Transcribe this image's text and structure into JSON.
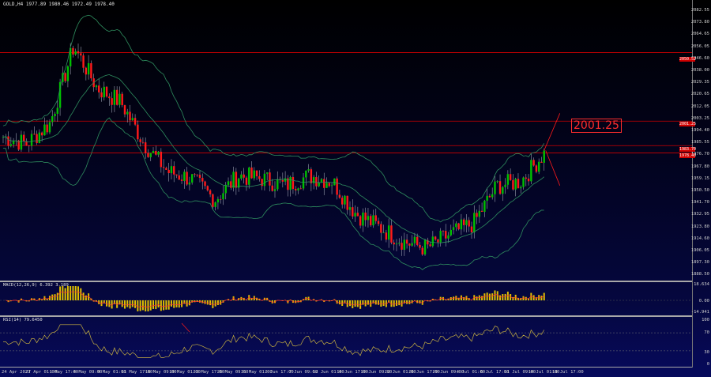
{
  "chart": {
    "symbol_header": "GOLD,H4  1977.89 1980.46 1972.49 1978.40",
    "callout_price": "2001.25",
    "price_axis": [
      "2082.55",
      "2073.80",
      "2064.65",
      "2056.05",
      "2046.60",
      "2038.00",
      "2029.35",
      "2020.65",
      "2012.05",
      "2003.25",
      "1994.40",
      "1985.55",
      "1976.70",
      "1967.80",
      "1959.15",
      "1950.50",
      "1941.70",
      "1932.95",
      "1923.80",
      "1914.60",
      "1906.05",
      "1897.30",
      "1888.50"
    ],
    "time_axis": [
      "24 Apr 2023",
      "27 Apr 01:00",
      "1 May 17:00",
      "4 May 09:00",
      "9 May 01:00",
      "11 May 17:00",
      "16 May 09:00",
      "19 May 01:00",
      "23 May 17:00",
      "26 May 09:00",
      "31 May 01:00",
      "2 Jun 17:00",
      "7 Jun 09:00",
      "12 Jun 01:00",
      "14 Jun 17:00",
      "19 Jun 09:00",
      "22 Jun 01:00",
      "26 Jun 17:00",
      "29 Jun 09:00",
      "4 Jul 01:00",
      "6 Jul 17:00",
      "11 Jul 09:00",
      "14 Jul 01:00",
      "18 Jul 17:00"
    ],
    "highlight_labels": [
      "2050.52",
      "2001.25",
      "1983.70",
      "1978.40"
    ],
    "macd_title": "MACD(12,26,9) 6.392 3.189",
    "macd_axis": [
      "18.634",
      "0.00",
      "-14.941"
    ],
    "rsi_title": "RSI(14) 79.6450",
    "rsi_axis": [
      "100",
      "70",
      "30",
      "0"
    ],
    "colors": {
      "bull": "#00c000",
      "bear": "#ff1a1a",
      "band": "#2f8f5f",
      "hline": "#d00000",
      "macd": "#e0c000",
      "signal": "#ff3030",
      "rsi": "#c8b040"
    }
  },
  "chart_data": {
    "type": "candlestick",
    "x": [
      "24 Apr 2023",
      "27 Apr 01:00",
      "1 May 17:00",
      "4 May 09:00",
      "9 May 01:00",
      "11 May 17:00",
      "16 May 09:00",
      "19 May 01:00",
      "23 May 17:00",
      "26 May 09:00",
      "31 May 01:00",
      "2 Jun 17:00",
      "7 Jun 09:00",
      "12 Jun 01:00",
      "14 Jun 17:00",
      "19 Jun 09:00",
      "22 Jun 01:00",
      "26 Jun 17:00",
      "29 Jun 09:00",
      "4 Jul 01:00",
      "6 Jul 17:00",
      "11 Jul 09:00",
      "14 Jul 01:00",
      "18 Jul 17:00"
    ],
    "close": [
      1990,
      1985,
      2000,
      2055,
      2025,
      2015,
      1985,
      1965,
      1960,
      1945,
      1962,
      1960,
      1955,
      1962,
      1958,
      1935,
      1925,
      1915,
      1910,
      1920,
      1928,
      1955,
      1958,
      1978
    ],
    "ylim": [
      1888.5,
      2082.55
    ],
    "levels": [
      2050.52,
      2001.25,
      1983.7,
      1978.4
    ]
  }
}
